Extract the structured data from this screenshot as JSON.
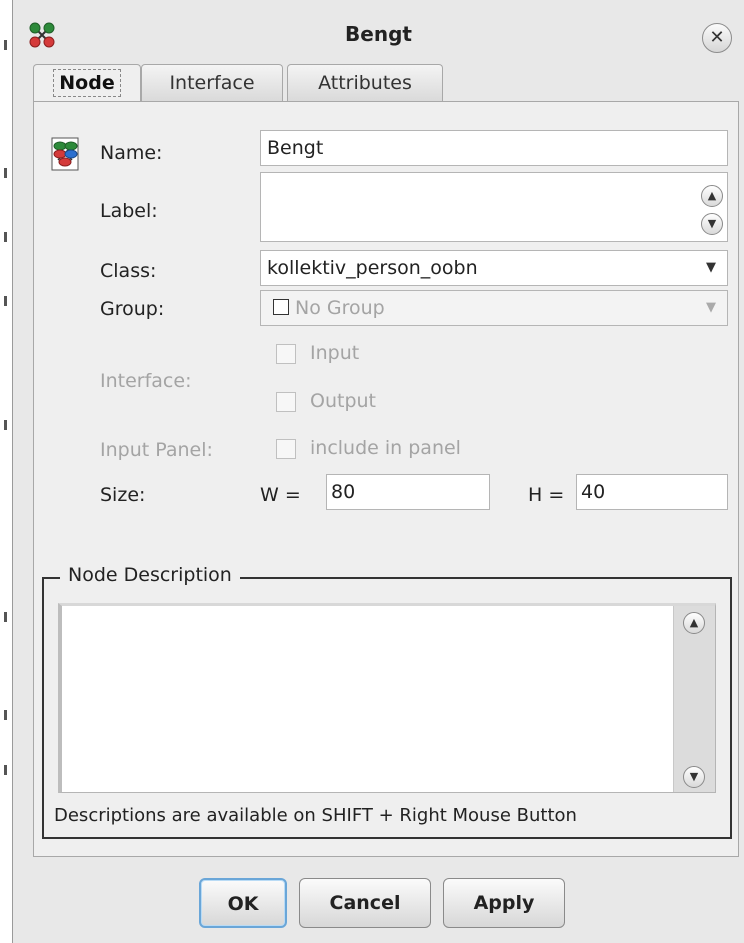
{
  "window": {
    "title": "Bengt",
    "icon": "network-nodes-icon"
  },
  "tabs": [
    {
      "label": "Node",
      "active": true
    },
    {
      "label": "Interface",
      "active": false
    },
    {
      "label": "Attributes",
      "active": false
    }
  ],
  "form": {
    "name": {
      "label": "Name:",
      "value": "Bengt"
    },
    "label": {
      "label": "Label:",
      "value": ""
    },
    "class": {
      "label": "Class:",
      "value": "kollektiv_person_oobn"
    },
    "group": {
      "label": "Group:",
      "value": "No Group"
    },
    "interface": {
      "label": "Interface:",
      "input_label": "Input",
      "output_label": "Output"
    },
    "input_panel": {
      "label": "Input Panel:",
      "checkbox_label": "include in panel"
    },
    "size": {
      "label": "Size:",
      "w_label": "W =",
      "w_value": "80",
      "h_label": "H =",
      "h_value": "40"
    }
  },
  "description": {
    "title": "Node Description",
    "value": "",
    "hint": "Descriptions are available on SHIFT + Right Mouse Button"
  },
  "buttons": {
    "ok": "OK",
    "cancel": "Cancel",
    "apply": "Apply"
  },
  "colors": {
    "default_button_border": "#6aa6d8",
    "disabled_text": "#a4a4a4"
  }
}
